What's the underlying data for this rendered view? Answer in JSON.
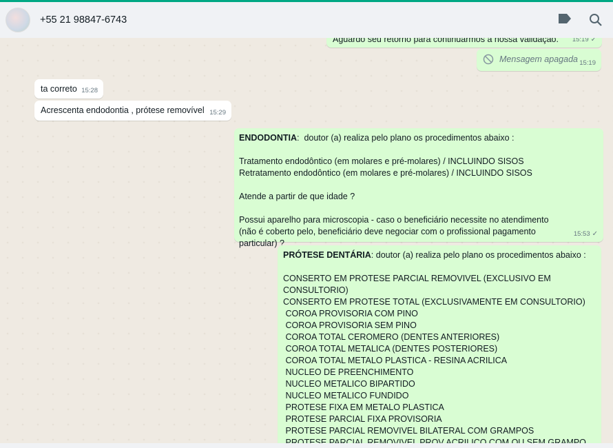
{
  "header": {
    "contact": "+55 21 98847-6743",
    "icons": [
      "label-icon",
      "search-icon"
    ]
  },
  "messages": [
    {
      "dir": "out",
      "text": "Aguardo seu retorno para continuarmos a nossa validação.",
      "time": "15:19"
    },
    {
      "dir": "out",
      "text": "Mensagem apagada",
      "time": "15:19",
      "deleted": true
    },
    {
      "dir": "in",
      "text": "ta correto",
      "time": "15:28"
    },
    {
      "dir": "in",
      "text": "Acrescenta endodontia , prótese removível",
      "time": "15:29"
    },
    {
      "dir": "out",
      "bold": "ENDODONTIA",
      "text": ":  doutor (a) realiza pelo plano os procedimentos abaixo :\n\nTratamento endodôntico (em molares e pré-molares) / INCLUINDO SISOS\nRetratamento endodôntico (em molares e pré-molares) / INCLUINDO SISOS\n\nAtende a partir de que idade ?\n\nPossui aparelho para microscopia - caso o beneficiário necessite no atendimento (não é coberto pelo, beneficiário deve negociar com o profissional pagamento particular) ?",
      "time": "15:53"
    },
    {
      "dir": "out",
      "bold": "PRÓTESE DENTÁRIA",
      "text": ": doutor (a) realiza pelo plano os procedimentos abaixo :\n\nCONSERTO EM PROTESE PARCIAL REMOVIVEL (EXCLUSIVO EM CONSULTORIO)\nCONSERTO EM PROTESE TOTAL (EXCLUSIVAMENTE EM CONSULTORIO)\n COROA PROVISORIA COM PINO\n COROA PROVISORIA SEM PINO\n COROA TOTAL CEROMERO (DENTES ANTERIORES)\n COROA TOTAL METALICA (DENTES POSTERIORES)\n COROA TOTAL METALO PLASTICA - RESINA ACRILICA\n NUCLEO DE PREENCHIMENTO\n NUCLEO METALICO BIPARTIDO\n NUCLEO METALICO FUNDIDO\n PROTESE FIXA EM METALO PLASTICA\n PROTESE PARCIAL FIXA PROVISORIA\n PROTESE PARCIAL REMOVIVEL BILATERAL COM GRAMPOS\n PROTESE PARCIAL REMOVIVEL PROV ACRILICO COM OU SEM GRAMPO\n PROTESE TOTAL"
    }
  ]
}
